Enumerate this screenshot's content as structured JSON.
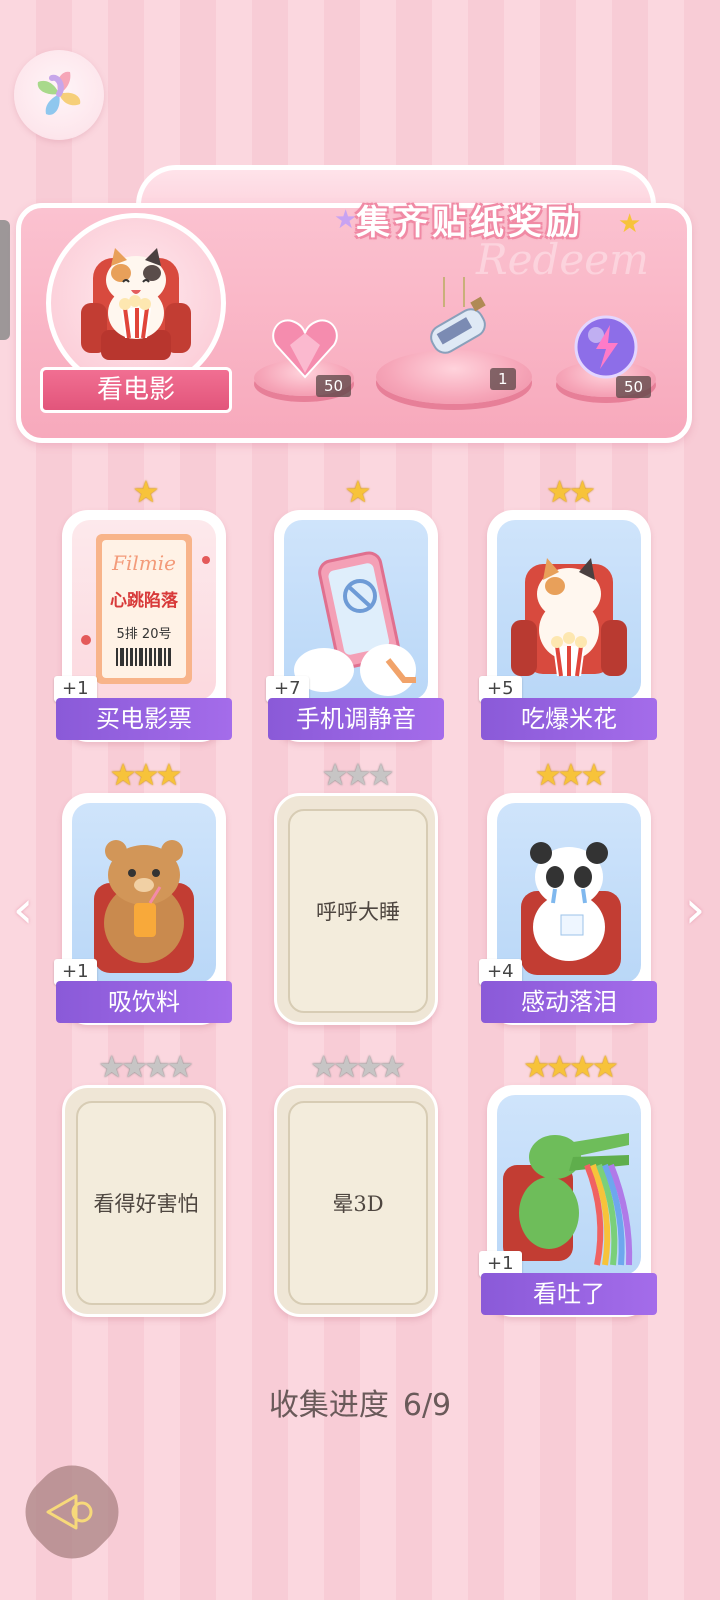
{
  "header": {
    "logo_icon": "app-pinwheel-icon"
  },
  "rewards": {
    "title": "集齐贴纸奖励",
    "watermark": "Redeem",
    "current_theme": "看电影",
    "items": [
      {
        "icon": "pink-heart-gem-icon",
        "count": "50"
      },
      {
        "icon": "bottle-charm-icon",
        "count": "1"
      },
      {
        "icon": "purple-lightning-orb-icon",
        "count": "50"
      }
    ]
  },
  "cards": [
    {
      "label": "买电影票",
      "stars": 1,
      "star_count": 1,
      "bonus": "+1",
      "collected": true,
      "art": "movie-ticket",
      "art_text": {
        "brand": "Filmie",
        "title": "心跳陷落",
        "seat": "5排 20号"
      }
    },
    {
      "label": "手机调静音",
      "stars": 1,
      "star_count": 1,
      "bonus": "+7",
      "collected": true,
      "art": "phone-silent"
    },
    {
      "label": "吃爆米花",
      "stars": 2,
      "star_count": 2,
      "bonus": "+5",
      "collected": true,
      "art": "cat-popcorn"
    },
    {
      "label": "吸饮料",
      "stars": 3,
      "star_count": 3,
      "bonus": "+1",
      "collected": true,
      "art": "bear-drink"
    },
    {
      "label": "呼呼大睡",
      "stars": 0,
      "star_count": 3,
      "bonus": "",
      "collected": false
    },
    {
      "label": "感动落泪",
      "stars": 3,
      "star_count": 3,
      "bonus": "+4",
      "collected": true,
      "art": "panda-crying"
    },
    {
      "label": "看得好害怕",
      "stars": 0,
      "star_count": 4,
      "bonus": "",
      "collected": false
    },
    {
      "label": "晕3D",
      "stars": 0,
      "star_count": 4,
      "bonus": "",
      "collected": false
    },
    {
      "label": "看吐了",
      "stars": 4,
      "star_count": 4,
      "bonus": "+1",
      "collected": true,
      "art": "crocodile-rainbow"
    }
  ],
  "progress": {
    "label": "收集进度",
    "value": "6/9"
  },
  "nav": {
    "prev_icon": "chevron-left-icon",
    "next_icon": "chevron-right-icon",
    "back_icon": "back-arrow-icon"
  },
  "colors": {
    "accent_pink": "#f16f92",
    "label_purple": "#9a62e2",
    "star_gold": "#f7c33a",
    "star_grey": "#c7c5c5"
  }
}
